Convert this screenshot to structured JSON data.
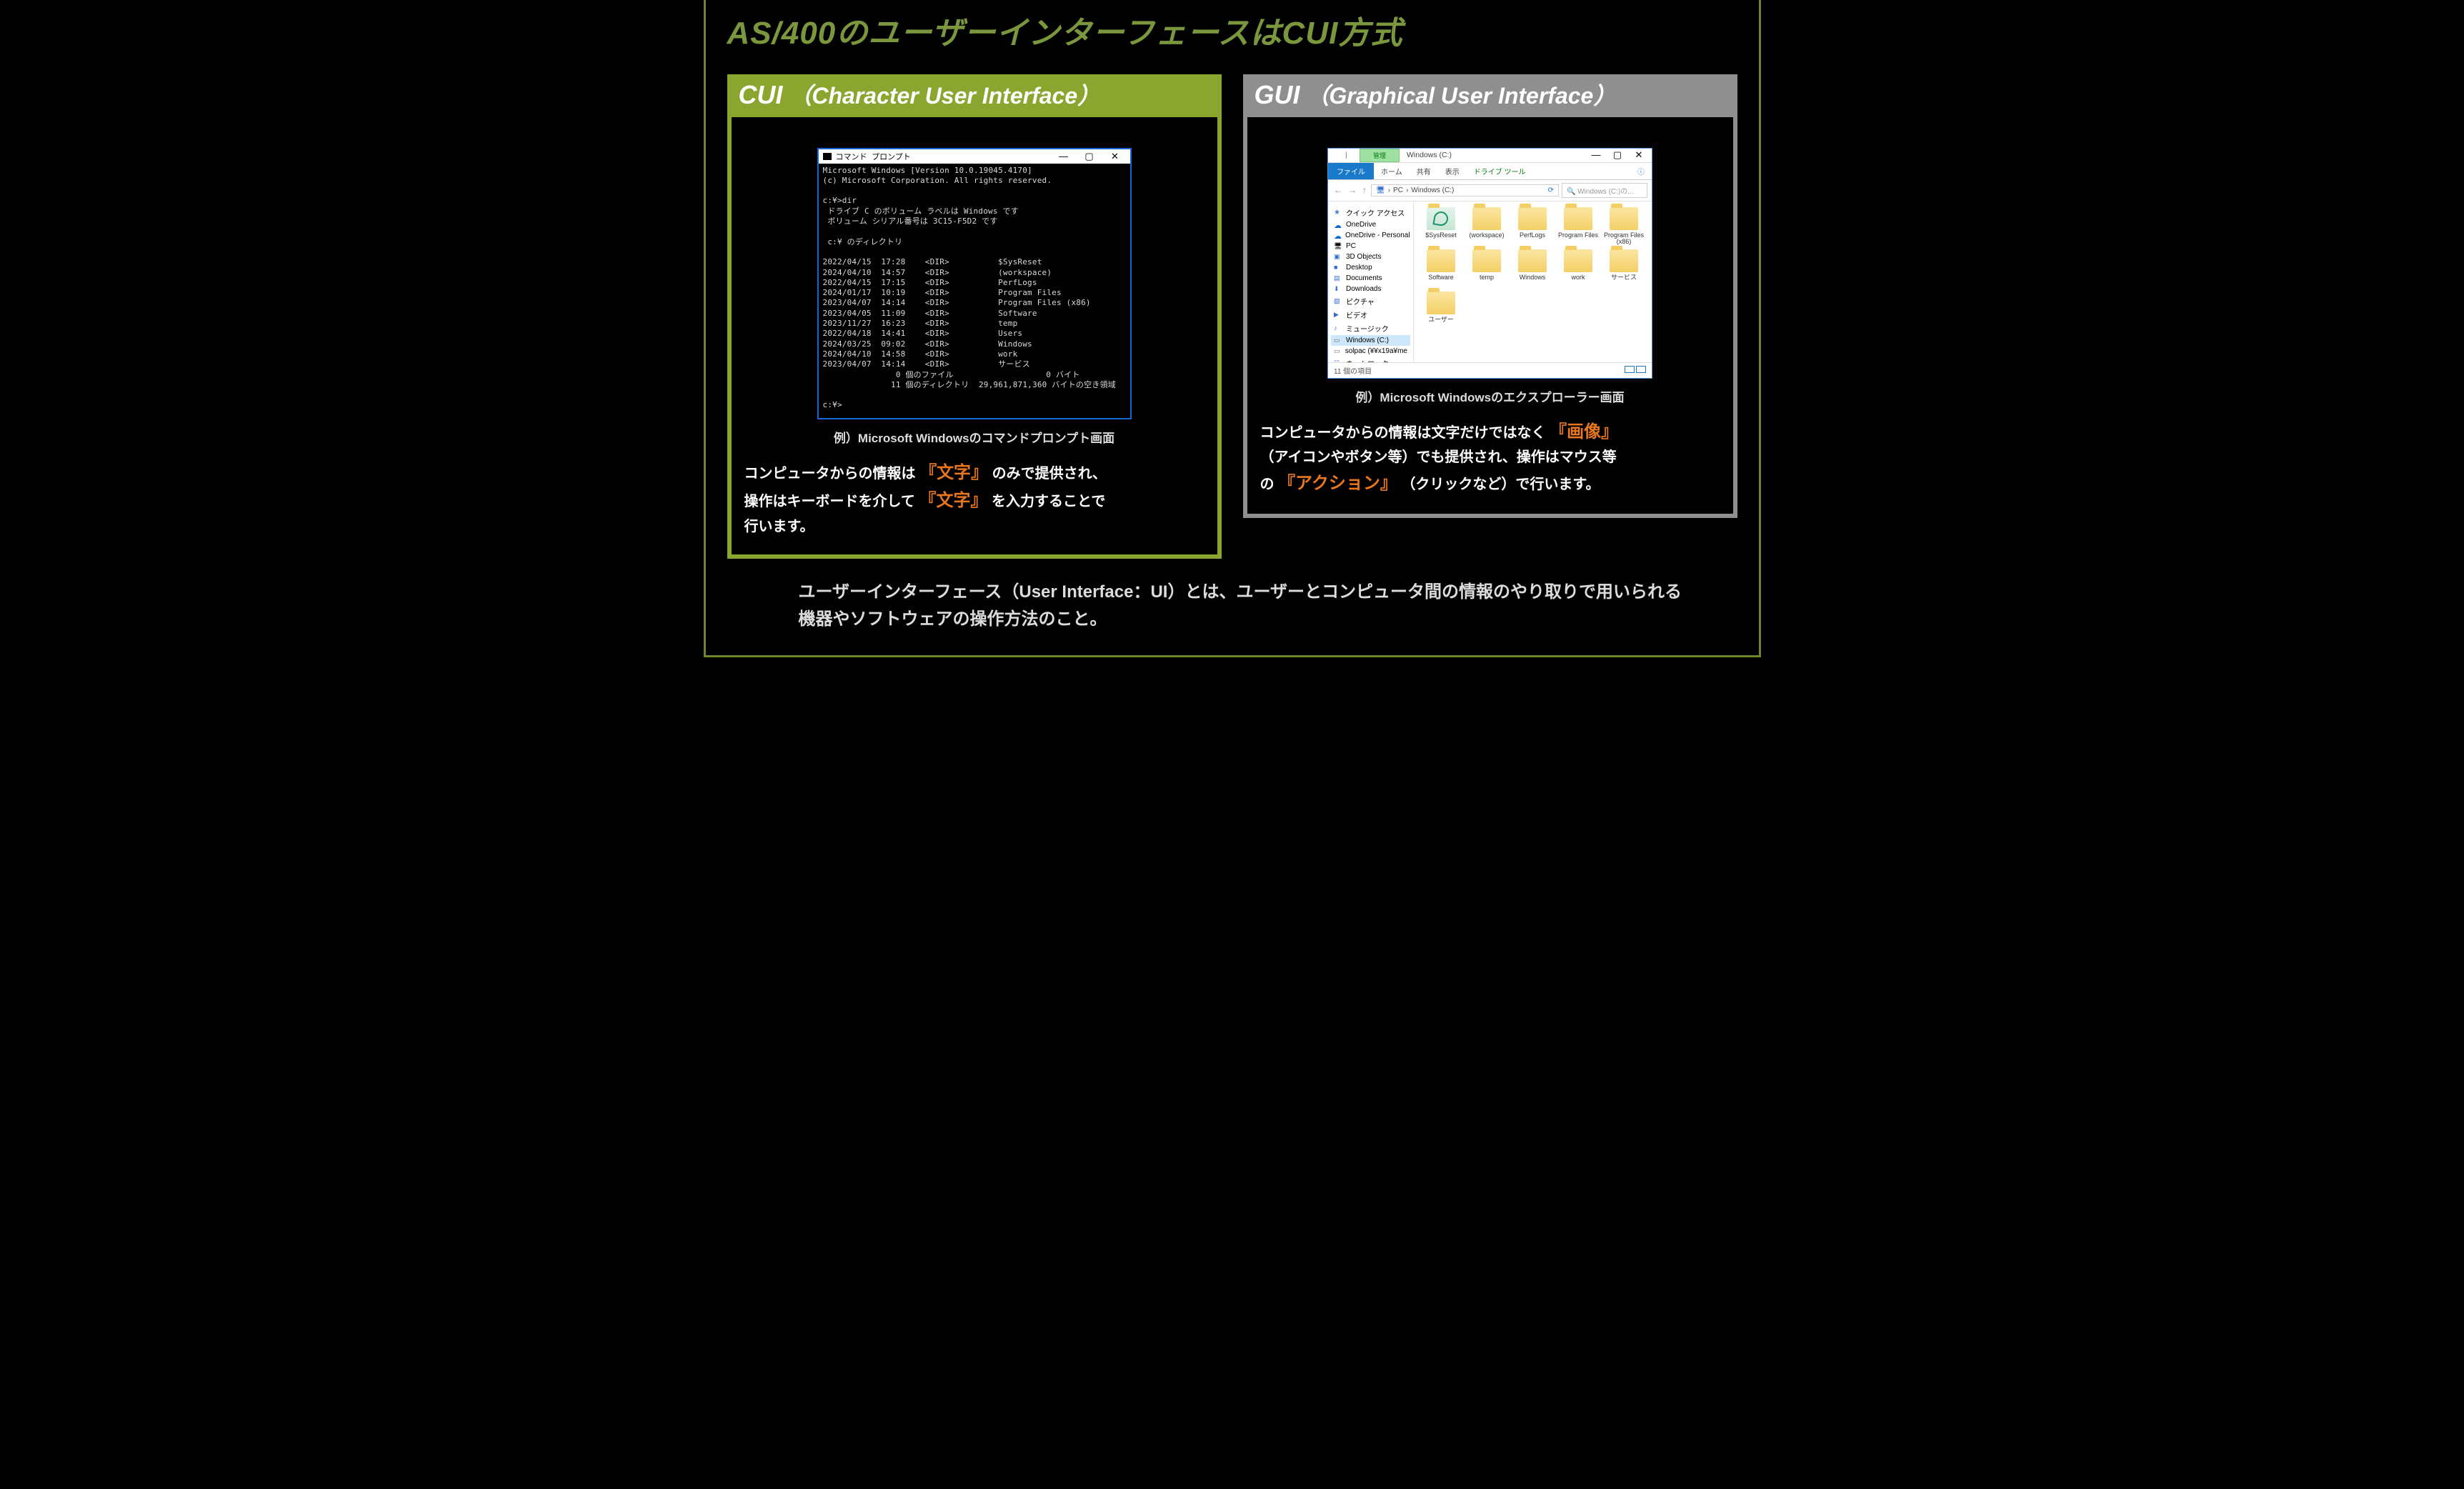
{
  "title": "AS/400のユーザーインターフェースはCUI方式",
  "cui": {
    "abbr": "CUI",
    "full": "（Character User Interface）",
    "window_title": "コマンド プロンプト",
    "winbtn_min": "—",
    "winbtn_max": "▢",
    "winbtn_close": "✕",
    "term_text": "Microsoft Windows [Version 10.0.19045.4170]\n(c) Microsoft Corporation. All rights reserved.\n\nc:¥>dir\n ドライブ C のボリューム ラベルは Windows です\n ボリューム シリアル番号は 3C15-F5D2 です\n\n c:¥ のディレクトリ\n\n2022/04/15  17:28    <DIR>          $SysReset\n2024/04/10  14:57    <DIR>          (workspace)\n2022/04/15  17:15    <DIR>          PerfLogs\n2024/01/17  10:19    <DIR>          Program Files\n2023/04/07  14:14    <DIR>          Program Files (x86)\n2023/04/05  11:09    <DIR>          Software\n2023/11/27  16:23    <DIR>          temp\n2022/04/18  14:41    <DIR>          Users\n2024/03/25  09:02    <DIR>          Windows\n2024/04/10  14:58    <DIR>          work\n2023/04/07  14:14    <DIR>          サービス\n               0 個のファイル                   0 バイト\n              11 個のディレクトリ  29,961,871,360 バイトの空き領域\n\nc:¥>",
    "caption": "例）Microsoft Windowsのコマンドプロンプト画面",
    "desc_parts": {
      "p1a": "コンピュータからの情報は",
      "hl1_open": "『",
      "hl1": "文字",
      "hl1_close": "』",
      "p1b": "のみで提供され、",
      "p2a": "操作はキーボードを介して",
      "hl2_open": "『",
      "hl2": "文字",
      "hl2_close": "』",
      "p2b": "を入力することで",
      "p3": "行います。"
    }
  },
  "gui": {
    "abbr": "GUI",
    "full": "（Graphical User Interface）",
    "manage_label": "管理",
    "title_text": "Windows (C:)",
    "winbtn_min": "—",
    "winbtn_max": "▢",
    "winbtn_close": "✕",
    "ribbon": {
      "file": "ファイル",
      "home": "ホーム",
      "share": "共有",
      "view": "表示",
      "drive": "ドライブ ツール",
      "caret": "ⓘ"
    },
    "addr": {
      "back": "←",
      "fwd": "→",
      "up": "↑",
      "pc": "PC",
      "sep": "›",
      "loc": "Windows (C:)",
      "refresh": "⟳",
      "search_placeholder": "Windows (C:)の..."
    },
    "nav": [
      {
        "icon": "star",
        "label": "クイック アクセス"
      },
      {
        "icon": "cloud",
        "label": "OneDrive"
      },
      {
        "icon": "cloud2",
        "label": "OneDrive - Personal"
      },
      {
        "icon": "pc",
        "label": "PC"
      },
      {
        "icon": "cube",
        "label": "3D Objects"
      },
      {
        "icon": "desk",
        "label": "Desktop"
      },
      {
        "icon": "doc",
        "label": "Documents"
      },
      {
        "icon": "dl",
        "label": "Downloads"
      },
      {
        "icon": "pic",
        "label": "ピクチャ"
      },
      {
        "icon": "vid",
        "label": "ビデオ"
      },
      {
        "icon": "mus",
        "label": "ミュージック"
      },
      {
        "icon": "hdd",
        "label": "Windows (C:)",
        "sel": true
      },
      {
        "icon": "hdd",
        "label": "solpac (¥¥x19a¥me"
      },
      {
        "icon": "net",
        "label": "ネットワーク"
      }
    ],
    "folders": [
      {
        "label": "$SysReset",
        "special": true
      },
      {
        "label": "(workspace)"
      },
      {
        "label": "PerfLogs"
      },
      {
        "label": "Program Files"
      },
      {
        "label": "Program Files (x86)"
      },
      {
        "label": "Software"
      },
      {
        "label": "temp"
      },
      {
        "label": "Windows"
      },
      {
        "label": "work"
      },
      {
        "label": "サービス"
      },
      {
        "label": "ユーザー"
      }
    ],
    "status": "11 個の項目",
    "caption": "例）Microsoft Windowsのエクスプローラー画面",
    "desc_parts": {
      "p0": "コンピュータからの情報は文字だけではなく",
      "hl1_open": "『",
      "hl1": "画像",
      "hl1_close": "』",
      "p1": "（アイコンやボタン等）でも提供され、操作はマウス等",
      "p2a": "の",
      "hl2_open": "『",
      "hl2": "アクション",
      "hl2_close": "』",
      "p2b": "（クリックなど）で行います。"
    }
  },
  "footer": "ユーザーインターフェース（User Interface：UI）とは、ユーザーとコンピュータ間の情報のやり取りで用いられる機器やソフトウェアの操作方法のこと。"
}
